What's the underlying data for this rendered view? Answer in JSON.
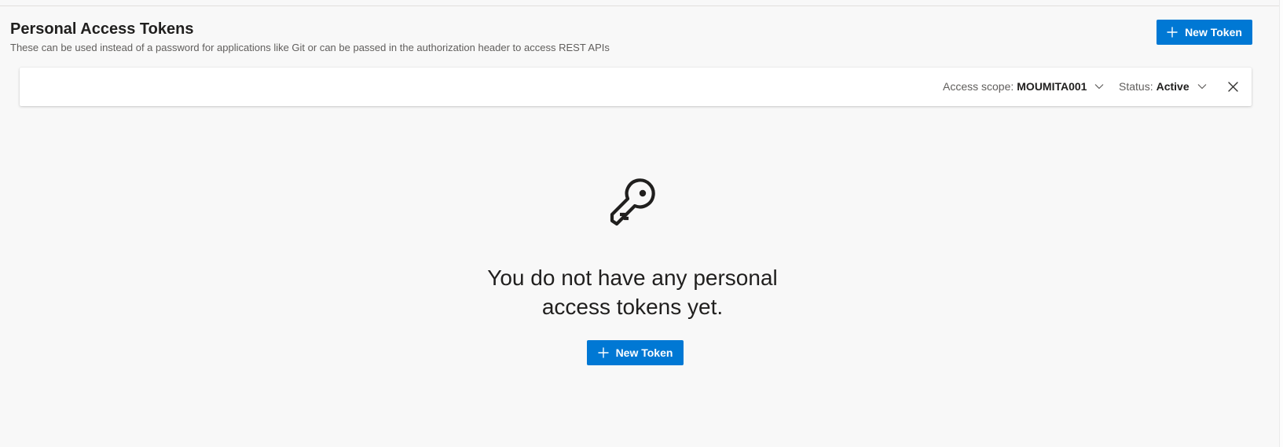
{
  "header": {
    "title": "Personal Access Tokens",
    "subtitle": "These can be used instead of a password for applications like Git or can be passed in the authorization header to access REST APIs",
    "new_token_label": "New Token"
  },
  "filters": {
    "scope_label": "Access scope:",
    "scope_value": "MOUMITA001",
    "status_label": "Status:",
    "status_value": "Active"
  },
  "empty_state": {
    "message": "You do not have any personal access tokens yet.",
    "new_token_label": "New Token"
  },
  "icons": {
    "plus": "plus-icon",
    "chevron": "chevron-down-icon",
    "close": "close-icon",
    "key": "key-icon"
  },
  "colors": {
    "primary": "#0078d4",
    "background": "#f8f8f8",
    "card": "#ffffff"
  }
}
